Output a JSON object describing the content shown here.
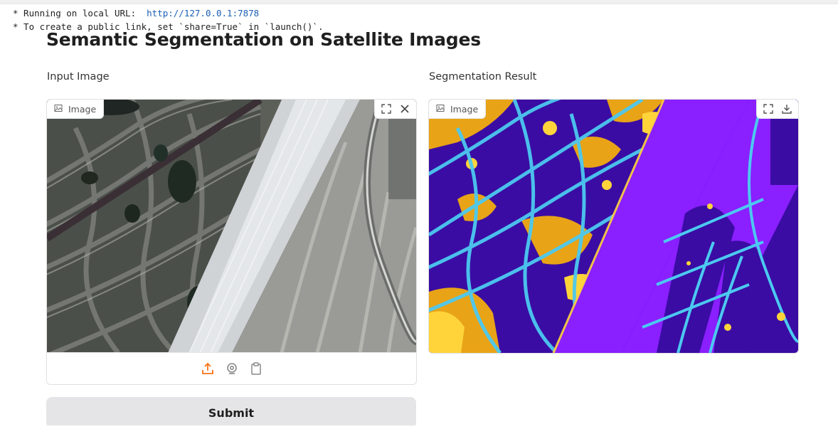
{
  "console": {
    "line1_prefix": "* Running on local URL:  ",
    "line1_url": "http://127.0.0.1:7878",
    "line2": "* To create a public link, set `share=True` in `launch()`."
  },
  "page_title": "Semantic Segmentation on Satellite Images",
  "input_panel": {
    "label": "Input Image",
    "tag_label": "Image",
    "tools": [
      "fullscreen-icon",
      "close-icon"
    ],
    "sources": [
      "upload-icon",
      "webcam-icon",
      "clipboard-icon"
    ]
  },
  "output_panel": {
    "label": "Segmentation Result",
    "tag_label": "Image",
    "tools": [
      "fullscreen-icon",
      "download-icon"
    ]
  },
  "submit_label": "Submit",
  "colors": {
    "accent_orange": "#f97316",
    "seg_class_a": "#8a1fff",
    "seg_class_b": "#3a0ca3",
    "seg_class_c": "#e8a317",
    "seg_class_d": "#4cc9f0",
    "seg_class_e": "#ffd43b"
  }
}
